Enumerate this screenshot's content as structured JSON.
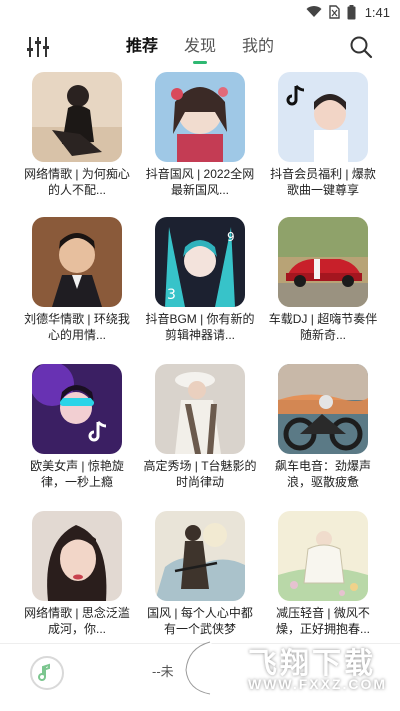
{
  "status_bar": {
    "time": "1:41"
  },
  "header": {
    "tabs": [
      {
        "label": "推荐"
      },
      {
        "label": "发现"
      },
      {
        "label": "我的"
      }
    ]
  },
  "cards": [
    {
      "caption": "网络情歌 | 为何痴心的人不配..."
    },
    {
      "caption": "抖音国风 | 2022全网最新国风..."
    },
    {
      "caption": "抖音会员福利 | 爆款歌曲一键尊享"
    },
    {
      "caption": "刘德华情歌 | 环绕我心的用情..."
    },
    {
      "caption": "抖音BGM | 你有新的剪辑神器请..."
    },
    {
      "caption": "车载DJ | 超嗨节奏伴随新奇..."
    },
    {
      "caption": "欧美女声 | 惊艳旋律，一秒上瘾"
    },
    {
      "caption": "高定秀场 | T台魅影的时尚律动"
    },
    {
      "caption": "飙车电音：劲爆声浪，驱散疲惫"
    },
    {
      "caption": "网络情歌 | 思念泛滥成河，你..."
    },
    {
      "caption": "国风 | 每个人心中都有一个武侠梦"
    },
    {
      "caption": "减压轻音 | 微风不燥，正好拥抱春..."
    }
  ],
  "player": {
    "track": "--未"
  },
  "watermark": {
    "text": "飞翔下载",
    "url": "WWW.FXXZ.COM"
  },
  "colors": {
    "accent": "#2eb872",
    "text": "#222222"
  }
}
